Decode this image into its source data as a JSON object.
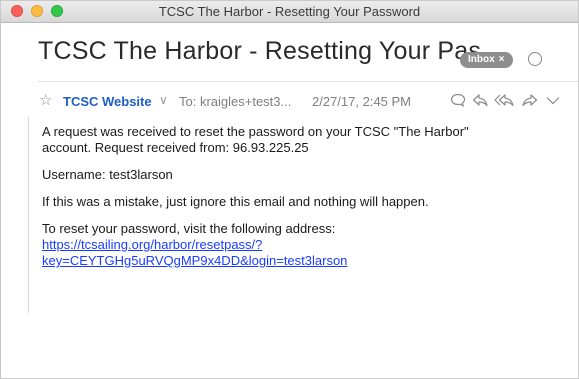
{
  "window": {
    "title": "TCSC The Harbor - Resetting Your Password"
  },
  "message": {
    "subject": "TCSC The Harbor - Resetting Your Pas...",
    "badge": "Inbox",
    "badge_close": "×",
    "from": "TCSC Website",
    "to": "To: kraigles+test3...",
    "date": "2/27/17, 2:45 PM",
    "body": {
      "p1_line1": "A request was received to reset the password on your TCSC \"The Harbor\"",
      "p1_line2": "account. Request received from: 96.93.225.25",
      "p2": "Username: test3larson",
      "p3": "If this was a mistake, just ignore this email and nothing will happen.",
      "p4": "To reset your password, visit the following address:",
      "link_line1": "https://tcsailing.org/harbor/resetpass/?",
      "link_line2": "key=CEYTGHg5uRVQgMP9x4DD&login=test3larson"
    }
  },
  "icons": [
    "star-icon",
    "chevron-down-icon",
    "speech-bubble-icon",
    "reply-icon",
    "reply-all-icon",
    "forward-icon",
    "chevron-down-icon"
  ],
  "colors": {
    "sender": "#1f5fc4",
    "link": "#1a3cff",
    "badge": "#8e8e8e",
    "close": "#fc605c",
    "minimize": "#fdbc40",
    "zoom": "#34c84a"
  }
}
